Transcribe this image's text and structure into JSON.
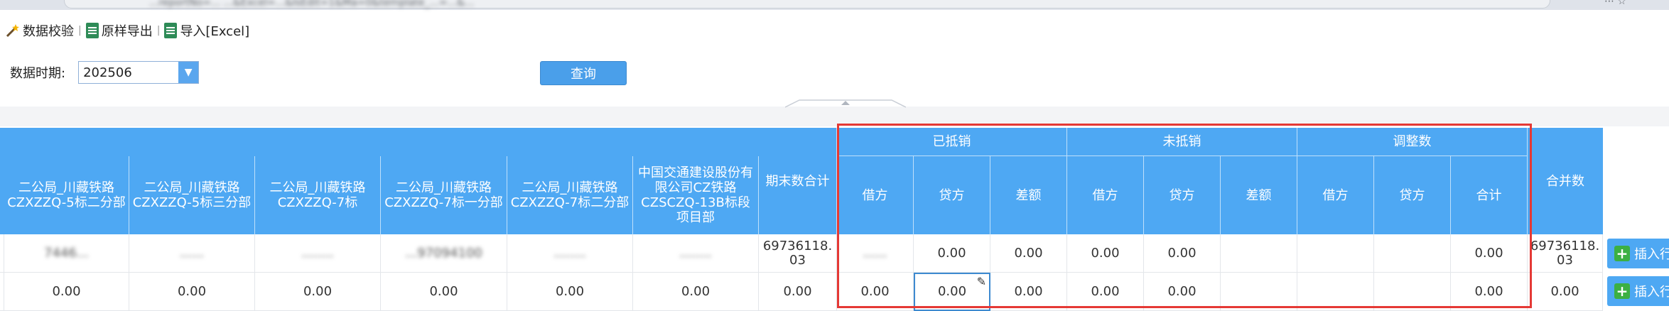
{
  "browser": {
    "url": "...reportNo=... ...&Excel=...&IsEdit=1&Ma=0&template_...=...&...",
    "icons": "⋯  ☆"
  },
  "toolbar": {
    "validate_label": "数据校验",
    "export_label": "原样导出",
    "import_label": "导入[Excel]"
  },
  "filter": {
    "period_label": "数据时期:",
    "period_value": "202506",
    "query_label": "查询"
  },
  "table": {
    "columns": [
      "二公局_川藏铁路CZXZZQ-5标二分部",
      "二公局_川藏铁路CZXZZQ-5标三分部",
      "二公局_川藏铁路CZXZZQ-7标",
      "二公局_川藏铁路CZXZZQ-7标一分部",
      "二公局_川藏铁路CZXZZQ-7标二分部",
      "中国交通建设股份有限公司CZ铁路CZSCZQ-13B标段项目部",
      "期末数合计"
    ],
    "groups": [
      "已抵销",
      "未抵销",
      "调整数"
    ],
    "sub_columns": {
      "offset": [
        "借方",
        "贷方",
        "差额"
      ],
      "unoffset": [
        "借方",
        "贷方",
        "差额"
      ],
      "adjust": [
        "借方",
        "贷方",
        "合计"
      ]
    },
    "merged_label": "合并数",
    "rows": [
      {
        "c1": "7446...",
        "c2": "......",
        "c3": "........",
        "c4": "...97094100",
        "c5": "........",
        "c6": "........",
        "total": "69736118.03",
        "off_debit": "......",
        "off_credit": "0.00",
        "off_diff": "0.00",
        "un_debit": "0.00",
        "un_credit": "0.00",
        "un_diff": "",
        "adj_debit": "",
        "adj_credit": "",
        "adj_total": "0.00",
        "merged": "69736118.03"
      },
      {
        "c1": "0.00",
        "c2": "0.00",
        "c3": "0.00",
        "c4": "0.00",
        "c5": "0.00",
        "c6": "0.00",
        "total": "0.00",
        "off_debit": "0.00",
        "off_credit": "0.00",
        "off_diff": "0.00",
        "un_debit": "0.00",
        "un_credit": "0.00",
        "un_diff": "",
        "adj_debit": "",
        "adj_credit": "",
        "adj_total": "0.00",
        "merged": "0.00"
      }
    ],
    "insert_row_label": "插入行"
  },
  "colors": {
    "header_bg": "#4ea8f3",
    "highlight": "#e53935",
    "button": "#4a9fea"
  }
}
